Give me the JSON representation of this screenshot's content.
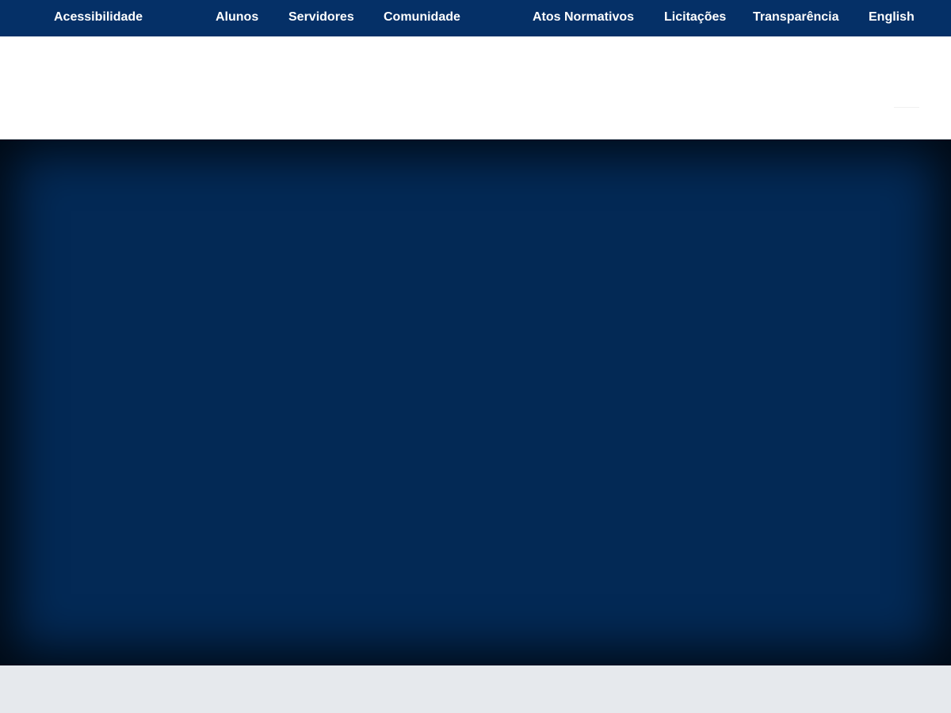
{
  "topbar": {
    "background": "#053067",
    "links": [
      {
        "label": "Acessibilidade"
      },
      {
        "label": "Alunos"
      },
      {
        "label": "Servidores"
      },
      {
        "label": "Comunidade"
      },
      {
        "label": "Atos Normativos"
      },
      {
        "label": "Licitações"
      },
      {
        "label": "Transparência"
      },
      {
        "label": "English"
      }
    ]
  },
  "hero": {
    "background": "#032955"
  },
  "footer": {
    "background": "#e6e9ed"
  }
}
